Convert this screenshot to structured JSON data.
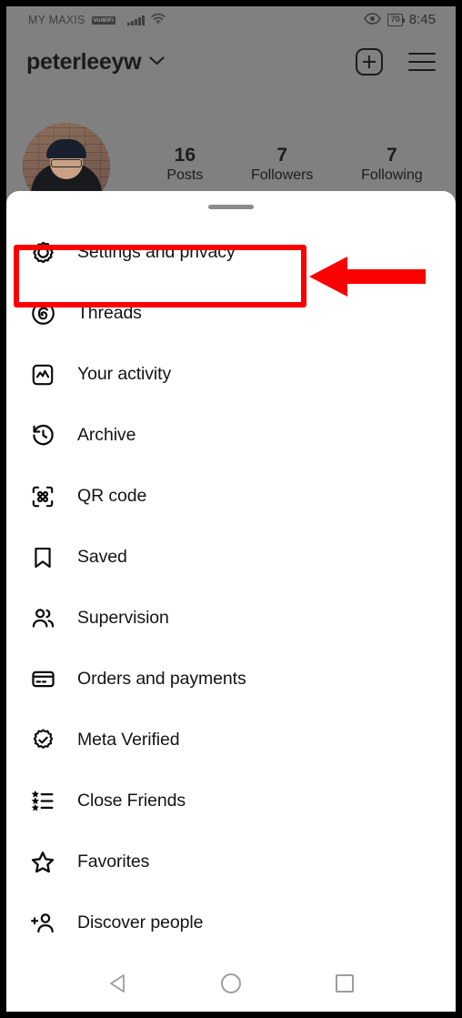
{
  "status_bar": {
    "carrier": "MY MAXIS",
    "network_badge": "VoWiFi",
    "signal_icon": "signal-bars-icon",
    "wifi_icon": "wifi-icon",
    "eye_icon": "eye-icon",
    "battery_level": "70",
    "time": "8:45"
  },
  "profile_header": {
    "username": "peterleeyw",
    "chevron_icon": "chevron-down-icon",
    "add_icon": "plus-square-icon",
    "menu_icon": "hamburger-menu-icon",
    "avatar_icon": "profile-avatar"
  },
  "stats": [
    {
      "count": "16",
      "label": "Posts"
    },
    {
      "count": "7",
      "label": "Followers"
    },
    {
      "count": "7",
      "label": "Following"
    }
  ],
  "sheet": {
    "grabber_icon": "drag-handle",
    "items": [
      {
        "label": "Settings and privacy",
        "icon": "gear-icon"
      },
      {
        "label": "Threads",
        "icon": "threads-icon"
      },
      {
        "label": "Your activity",
        "icon": "activity-chart-icon"
      },
      {
        "label": "Archive",
        "icon": "clock-rewind-icon"
      },
      {
        "label": "QR code",
        "icon": "qr-code-icon"
      },
      {
        "label": "Saved",
        "icon": "bookmark-icon"
      },
      {
        "label": "Supervision",
        "icon": "two-people-icon"
      },
      {
        "label": "Orders and payments",
        "icon": "credit-card-icon"
      },
      {
        "label": "Meta Verified",
        "icon": "verified-badge-icon"
      },
      {
        "label": "Close Friends",
        "icon": "star-list-icon"
      },
      {
        "label": "Favorites",
        "icon": "star-icon"
      },
      {
        "label": "Discover people",
        "icon": "add-person-icon"
      }
    ]
  },
  "annotation": {
    "highlight_target": "Settings and privacy",
    "box_icon": "red-highlight-box",
    "arrow_icon": "red-left-arrow",
    "color": "#fb0000"
  },
  "nav_bar": {
    "back_icon": "back-triangle-icon",
    "home_icon": "home-circle-icon",
    "recents_icon": "recents-square-icon"
  },
  "colors": {
    "scrim": "#808080",
    "sheet_bg": "#ffffff",
    "text": "#141414",
    "annotation": "#fb0000"
  }
}
